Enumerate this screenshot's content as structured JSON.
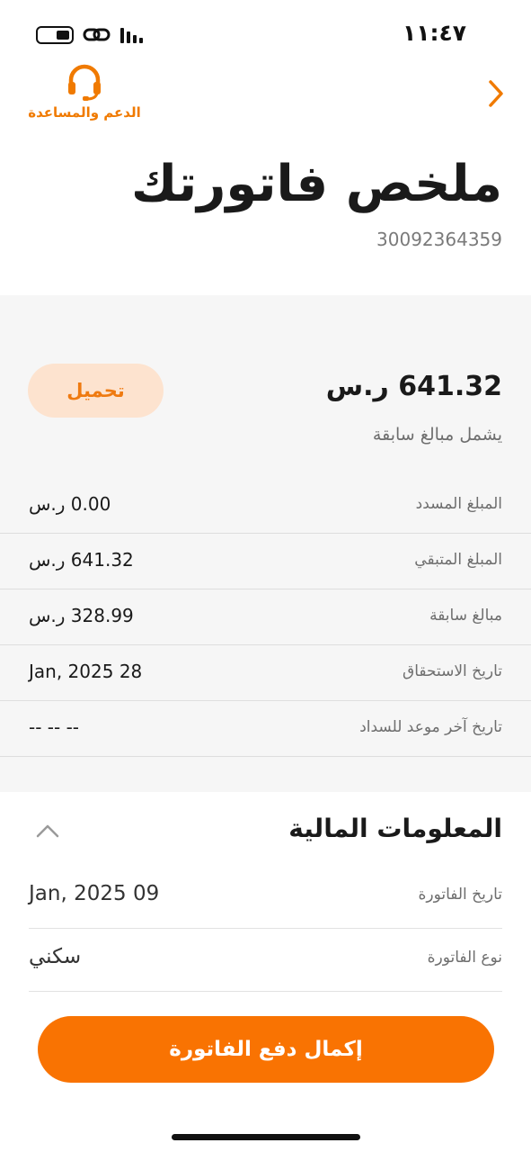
{
  "status_bar": {
    "time": "١١:٤٧"
  },
  "header": {
    "support_label": "الدعم والمساعدة",
    "support_icon": "headset-icon",
    "back_icon": "chevron-right-icon"
  },
  "page": {
    "title": "ملخص فاتورتك",
    "account_number": "30092364359"
  },
  "summary": {
    "total_amount": "641.32 ر.س",
    "includes_note": "يشمل مبالغ سابقة",
    "download_label": "تحميل",
    "rows": [
      {
        "label": "المبلغ المسدد",
        "value": "0.00 ر.س"
      },
      {
        "label": "المبلغ المتبقي",
        "value": "641.32 ر.س"
      },
      {
        "label": "مبالغ سابقة",
        "value": "328.99 ر.س"
      },
      {
        "label": "تاريخ الاستحقاق",
        "value": "28 Jan, 2025"
      },
      {
        "label": "تاريخ آخر موعد للسداد",
        "value": "-- -- --"
      }
    ]
  },
  "financial": {
    "title": "المعلومات المالية",
    "collapse_icon": "chevron-up-icon",
    "rows": [
      {
        "label": "تاريخ الفاتورة",
        "value": "09 Jan, 2025"
      },
      {
        "label": "نوع الفاتورة",
        "value": "سكني"
      }
    ]
  },
  "footer": {
    "pay_label": "إكمال دفع الفاتورة"
  },
  "colors": {
    "accent": "#f97302",
    "accent_soft": "#fde3cf",
    "summary_bg": "#f6f6f6"
  }
}
